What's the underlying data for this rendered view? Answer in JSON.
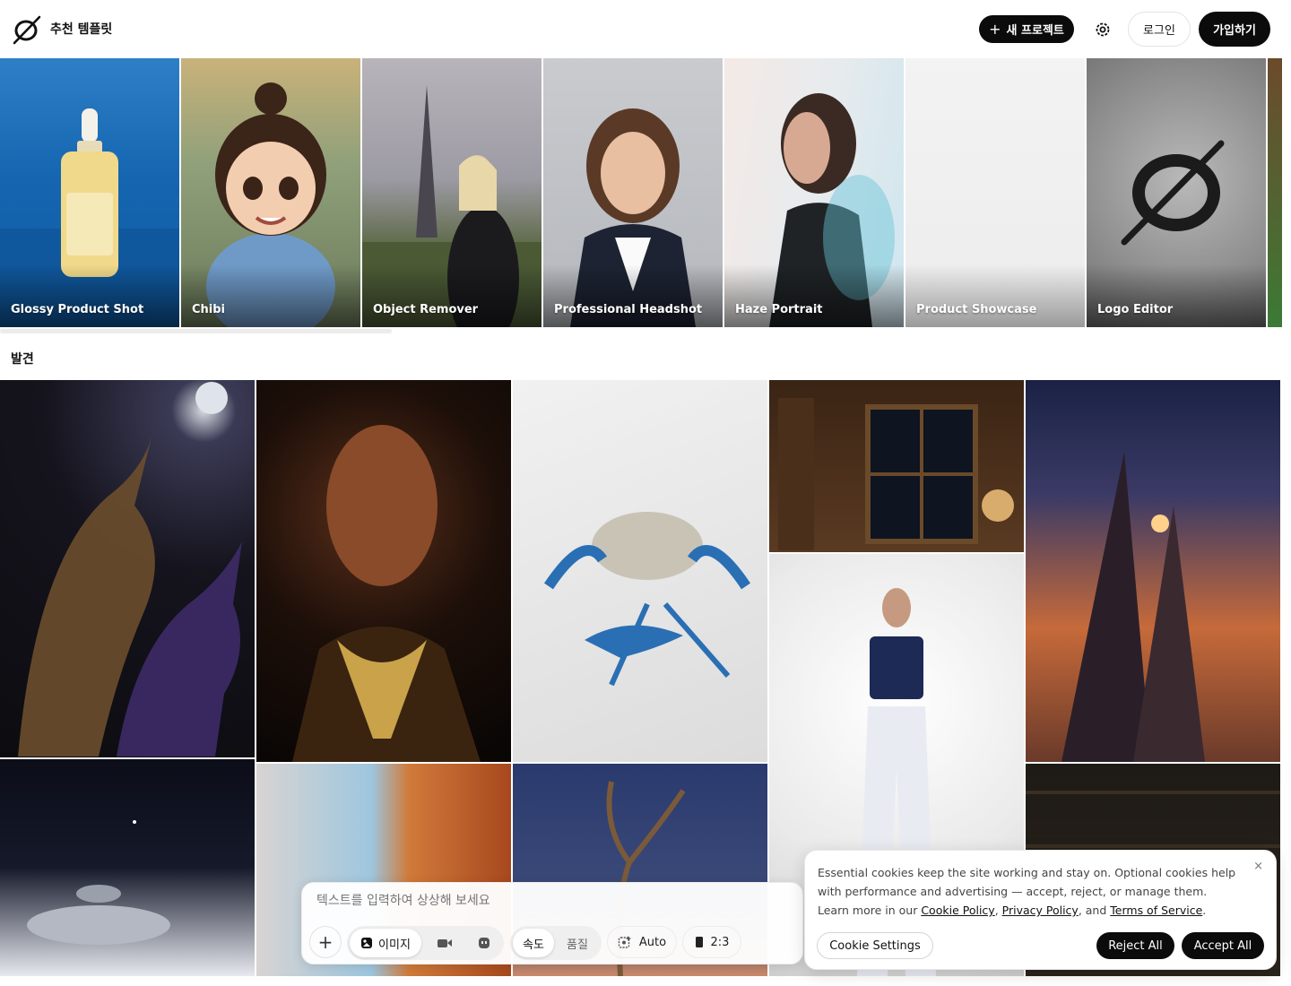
{
  "header": {
    "brand": "추천 템플릿",
    "new_project": "새 프로젝트",
    "login": "로그인",
    "signup": "가입하기"
  },
  "templates": [
    {
      "label": "Glossy Product Shot",
      "icon": "serum-bottle"
    },
    {
      "label": "Chibi",
      "icon": "chibi-character"
    },
    {
      "label": "Object Remover",
      "icon": "eiffel-tower-woman"
    },
    {
      "label": "Professional Headshot",
      "icon": "woman-headshot"
    },
    {
      "label": "Haze Portrait",
      "icon": "hazy-portrait"
    },
    {
      "label": "Product Showcase",
      "icon": "blank-showcase"
    },
    {
      "label": "Logo Editor",
      "icon": "chrome-logo"
    }
  ],
  "discover": {
    "title": "발견",
    "tiles": [
      "dragons",
      "gold-jewelry-woman",
      "blue-crab",
      "cozy-room-window",
      "alien-spires",
      "space-station",
      "blue-orange-abstract",
      "twisted-tree-night",
      "fashion-model",
      "library-shelves"
    ]
  },
  "prompt": {
    "placeholder": "텍스트를 입력하여 상상해 보세요",
    "image_tab": "이미지",
    "speed": "속도",
    "quality": "품질",
    "auto": "Auto",
    "ratio": "2:3"
  },
  "cookie": {
    "text_before": "Essential cookies keep the site working and stay on. Optional cookies help with performance and advertising — accept, reject, or manage them. Learn more in our ",
    "cookie_policy": "Cookie Policy",
    "sep1": ", ",
    "privacy_policy": "Privacy Policy",
    "sep2": ", and ",
    "terms": "Terms of Service",
    "end": ".",
    "close": "×",
    "settings": "Cookie Settings",
    "reject": "Reject All",
    "accept": "Accept All"
  },
  "colors": {
    "primary_button": "#0b0b0b",
    "page_bg": "#ffffff"
  }
}
